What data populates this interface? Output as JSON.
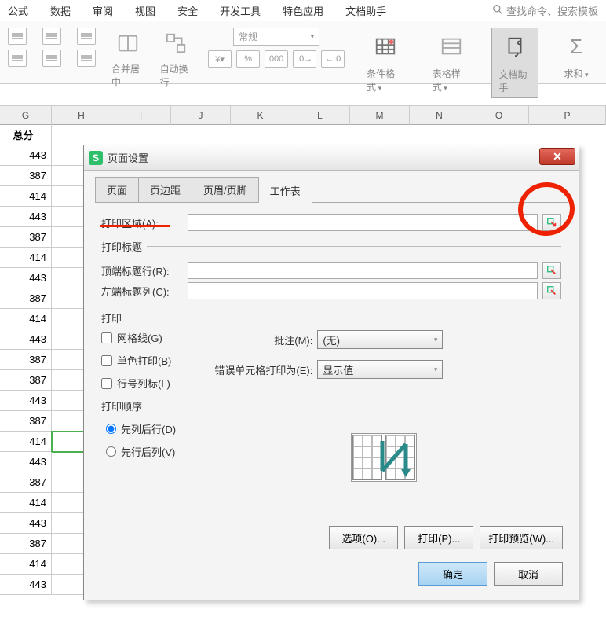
{
  "menu": {
    "items": [
      "公式",
      "数据",
      "审阅",
      "视图",
      "安全",
      "开发工具",
      "特色应用",
      "文档助手"
    ],
    "search_placeholder": "查找命令、搜索模板"
  },
  "ribbon": {
    "merge": "合并居中",
    "wrap": "自动换行",
    "number_format": "常规",
    "cond_format": "条件格式",
    "table_style": "表格样式",
    "doc_helper": "文档助手",
    "sum": "求和"
  },
  "cols": [
    "G",
    "H",
    "I",
    "J",
    "K",
    "L",
    "M",
    "N",
    "O",
    "P"
  ],
  "grid": {
    "header": "总分",
    "values": [
      443,
      387,
      414,
      443,
      387,
      414,
      443,
      387,
      414,
      443,
      387,
      387,
      443,
      387,
      414,
      443,
      387,
      414,
      443,
      387,
      414,
      443
    ],
    "selected_index": 14
  },
  "dialog": {
    "title": "页面设置",
    "tabs": [
      "页面",
      "页边距",
      "页眉/页脚",
      "工作表"
    ],
    "active_tab": 3,
    "print_area_label": "打印区域(A):",
    "print_titles": "打印标题",
    "top_row_label": "顶端标题行(R):",
    "left_col_label": "左端标题列(C):",
    "print_section": "打印",
    "cb_grid": "网格线(G)",
    "cb_mono": "单色打印(B)",
    "cb_rowcol": "行号列标(L)",
    "comments_label": "批注(M):",
    "comments_value": "(无)",
    "errors_label": "错误单元格打印为(E):",
    "errors_value": "显示值",
    "order_section": "打印顺序",
    "rb_down": "先列后行(D)",
    "rb_over": "先行后列(V)",
    "btn_options": "选项(O)...",
    "btn_print": "打印(P)...",
    "btn_preview": "打印预览(W)...",
    "btn_ok": "确定",
    "btn_cancel": "取消"
  }
}
